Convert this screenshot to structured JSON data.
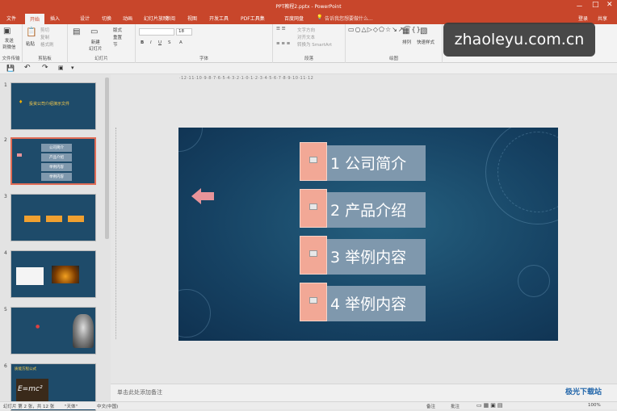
{
  "window": {
    "title": "PPT教程2.pptx - PowerPoint",
    "controls": [
      "－",
      "□",
      "✕"
    ]
  },
  "tabs": [
    "文件",
    "开始",
    "插入",
    "设计",
    "切换",
    "动画",
    "幻灯片放映",
    "审阅",
    "视图",
    "开发工具",
    "PDF工具集",
    "百度网盘"
  ],
  "active_tab": "开始",
  "tell_me": "告诉我您想要做什么...",
  "account": {
    "login": "登录",
    "share": "共享"
  },
  "ribbon": {
    "new_slide": "新建\n幻灯片",
    "layout": "版式",
    "reset": "重置",
    "section": "节",
    "font_size": "18",
    "text_dir": "文字方向",
    "align_text": "对齐文本",
    "smartart": "转换为 SmartArt",
    "arrange": "排列",
    "quick_styles": "快速样式",
    "send_to_wechat": "发送\n到微信",
    "groups": {
      "file_transfer": "文件传输",
      "clipboard": "剪贴板",
      "slides": "幻灯片",
      "font": "字体",
      "paragraph": "段落",
      "drawing": "绘图"
    },
    "paste": "粘贴",
    "cut": "剪切",
    "copy": "复制",
    "format_painter": "格式刷"
  },
  "ruler_h": "·12·11·10·9·8·7·6·5·4·3·2·1·0·1·2·3·4·5·6·7·8·9·10·11·12",
  "thumbnails": [
    {
      "num": "1",
      "title": "投资公司介绍演示文件",
      "subtitle": ""
    },
    {
      "num": "2",
      "items": [
        "公司简介",
        "产品介绍",
        "举例内容",
        "举例内容"
      ]
    },
    {
      "num": "3"
    },
    {
      "num": "4",
      "star": "*"
    },
    {
      "num": "5",
      "star": "*"
    },
    {
      "num": "6",
      "title": "质能方程公式",
      "formula": "E=mc²"
    }
  ],
  "slide": {
    "items": [
      "1 公司简介",
      "2 产品介绍",
      "3 举例内容",
      "4 举例内容"
    ]
  },
  "notes_placeholder": "单击此处添加备注",
  "status": {
    "slide_info": "幻灯片 第 2 张，共 12 张",
    "theme": "\"天体\"",
    "language": "中文(中国)",
    "notes": "备注",
    "comments": "批注",
    "zoom": "100%"
  },
  "watermark": "zhaoleyu.com.cn",
  "logo_text": "极光下载站",
  "colors": {
    "accent": "#c8462b",
    "slide_bg": "#164263",
    "item_square": "#f2a896",
    "item_bar": "#7f98ad",
    "arrow": "#e8949a"
  }
}
